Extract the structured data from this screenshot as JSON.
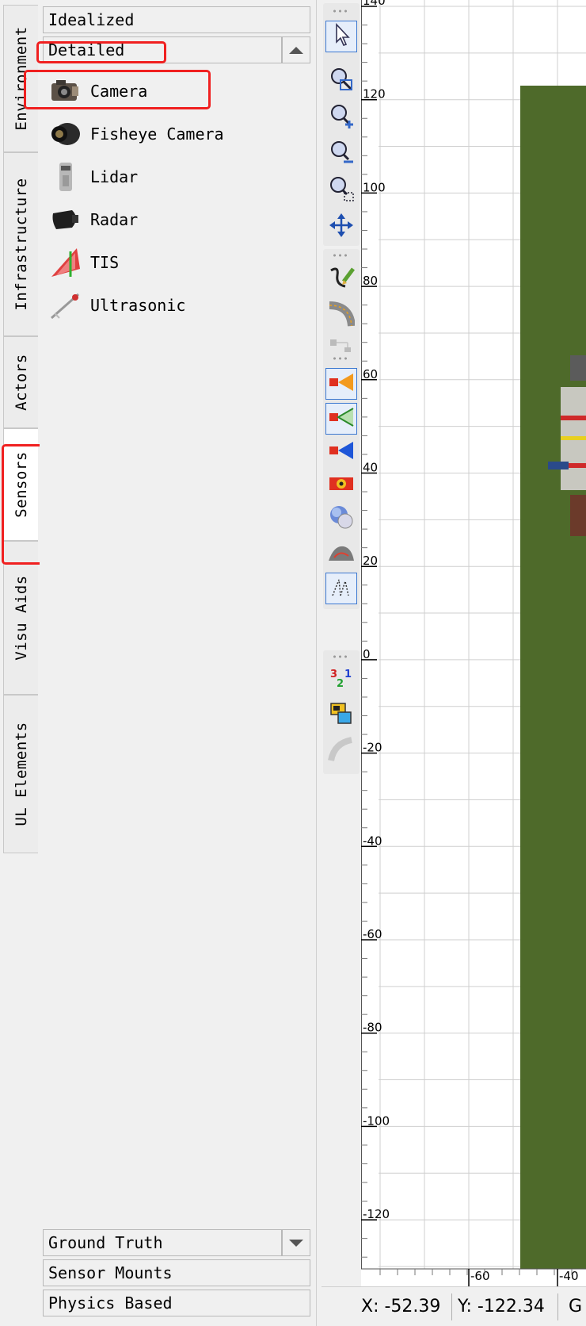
{
  "side_tabs": [
    {
      "label": "Environment"
    },
    {
      "label": "Infrastructure"
    },
    {
      "label": "Actors"
    },
    {
      "label": "Sensors"
    },
    {
      "label": "Visu Aids"
    },
    {
      "label": "UL Elements"
    }
  ],
  "active_side_tab": "Sensors",
  "palette": {
    "groups_top": [
      "Idealized",
      "Detailed"
    ],
    "items": [
      {
        "label": "Camera",
        "icon": "camera-icon"
      },
      {
        "label": "Fisheye Camera",
        "icon": "fisheye-camera-icon"
      },
      {
        "label": "Lidar",
        "icon": "lidar-icon"
      },
      {
        "label": "Radar",
        "icon": "radar-icon"
      },
      {
        "label": "TIS",
        "icon": "tis-icon"
      },
      {
        "label": "Ultrasonic",
        "icon": "ultrasonic-icon"
      }
    ],
    "groups_bottom": [
      "Ground Truth",
      "Sensor Mounts",
      "Physics Based"
    ]
  },
  "toolbar": {
    "tools": [
      "select-arrow-icon",
      "zoom-fit-icon",
      "zoom-in-icon",
      "zoom-out-icon",
      "zoom-region-icon",
      "pan-icon",
      "draw-road-icon",
      "curved-road-icon",
      "road-network-icon",
      "sensor-orange-icon",
      "sensor-green-icon",
      "sensor-blue-icon",
      "sensor-target-icon",
      "globe-icon",
      "terrain-icon",
      "trajectory-icon",
      "numbering-icon",
      "layers-icon",
      "arc-icon"
    ]
  },
  "viewport": {
    "y_ticks": [
      "140",
      "120",
      "100",
      "80",
      "60",
      "40",
      "20",
      "0",
      "-20",
      "-40",
      "-60",
      "-80",
      "-100",
      "-120"
    ],
    "x_ticks": [
      "-60",
      "-40"
    ],
    "colors": {
      "grass": "#4e6a2a",
      "grid": "#cfcfcf",
      "highlight": "#f02020"
    }
  },
  "status": {
    "x": "X: -52.39",
    "y": "Y: -122.34",
    "g": "G"
  }
}
